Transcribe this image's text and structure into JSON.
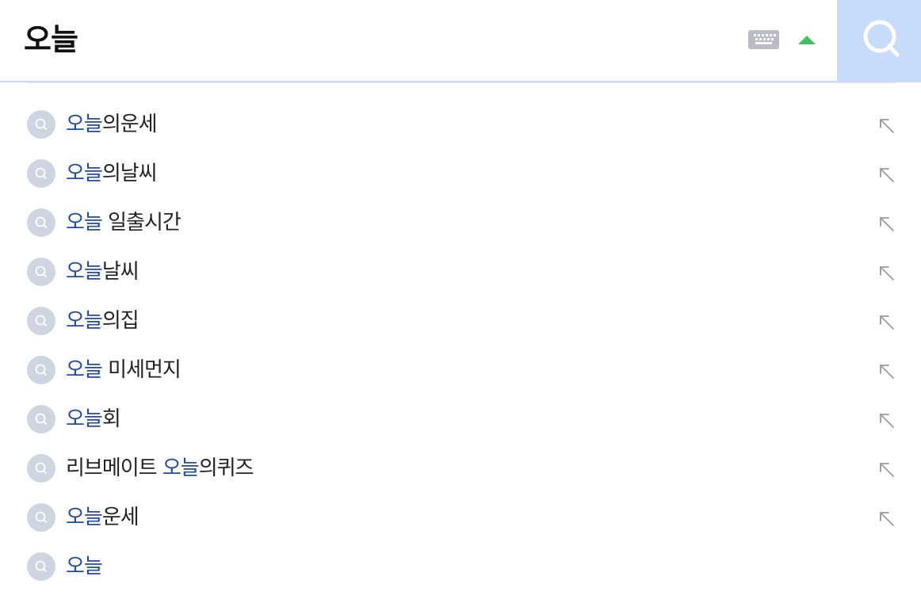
{
  "search": {
    "query": "오늘",
    "keyboard_icon": "keyboard-icon",
    "toggle_icon": "caret-up-icon",
    "search_icon": "search-icon",
    "accent_color": "#1f4aa8",
    "button_bg": "#c7dbfb"
  },
  "suggestions": [
    {
      "pre": "",
      "hl": "오늘",
      "post": "의운세",
      "fill": true
    },
    {
      "pre": "",
      "hl": "오늘",
      "post": "의날씨",
      "fill": true
    },
    {
      "pre": "",
      "hl": "오늘",
      "post": " 일출시간",
      "fill": true
    },
    {
      "pre": "",
      "hl": "오늘",
      "post": "날씨",
      "fill": true
    },
    {
      "pre": "",
      "hl": "오늘",
      "post": "의집",
      "fill": true
    },
    {
      "pre": "",
      "hl": "오늘",
      "post": " 미세먼지",
      "fill": true
    },
    {
      "pre": "",
      "hl": "오늘",
      "post": "회",
      "fill": true
    },
    {
      "pre": "리브메이트 ",
      "hl": "오늘",
      "post": "의퀴즈",
      "fill": true
    },
    {
      "pre": "",
      "hl": "오늘",
      "post": "운세",
      "fill": true
    },
    {
      "pre": "",
      "hl": "오늘",
      "post": "",
      "fill": false
    }
  ]
}
